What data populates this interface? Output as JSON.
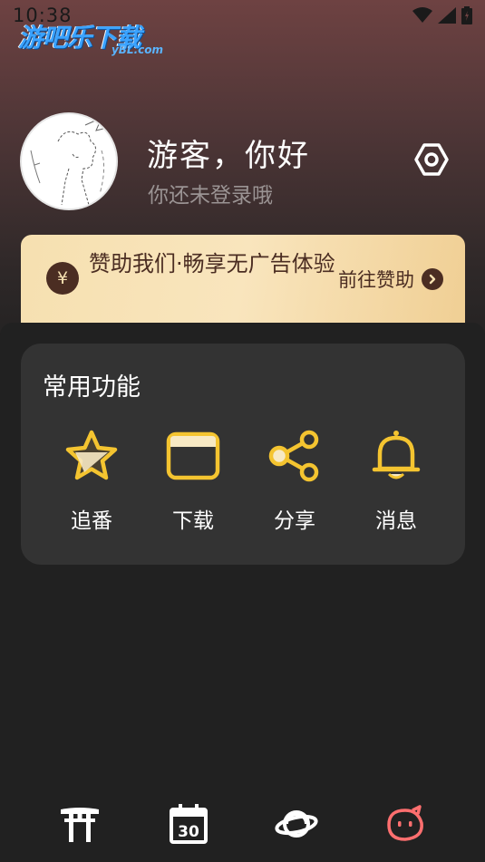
{
  "status_bar": {
    "time": "10:38",
    "icons": [
      "wifi-icon",
      "signal-icon",
      "battery-icon"
    ]
  },
  "watermark": {
    "title": "游吧乐下载",
    "subtitle": "yBL.com"
  },
  "profile": {
    "greeting": "游客，你好",
    "login_hint": "你还未登录哦",
    "settings_icon": "settings-hexagon-icon"
  },
  "sponsor": {
    "currency_symbol": "¥",
    "text": "赞助我们·畅享无广告体验",
    "link_label": "前往赞助"
  },
  "functions": {
    "title": "常用功能",
    "items": [
      {
        "label": "追番",
        "icon": "star-icon"
      },
      {
        "label": "下载",
        "icon": "folder-icon"
      },
      {
        "label": "分享",
        "icon": "share-icon"
      },
      {
        "label": "消息",
        "icon": "bell-icon"
      }
    ]
  },
  "tabbar": {
    "tabs": [
      {
        "icon": "torii-gate-icon",
        "active": false
      },
      {
        "icon": "calendar-30-icon",
        "active": false
      },
      {
        "icon": "planet-icon",
        "active": false
      },
      {
        "icon": "face-icon",
        "active": true
      }
    ]
  },
  "colors": {
    "accent_yellow": "#f4c430",
    "sponsor_text": "#4b2d22",
    "active_tab": "#ff6f6f",
    "card_bg": "#333333"
  }
}
